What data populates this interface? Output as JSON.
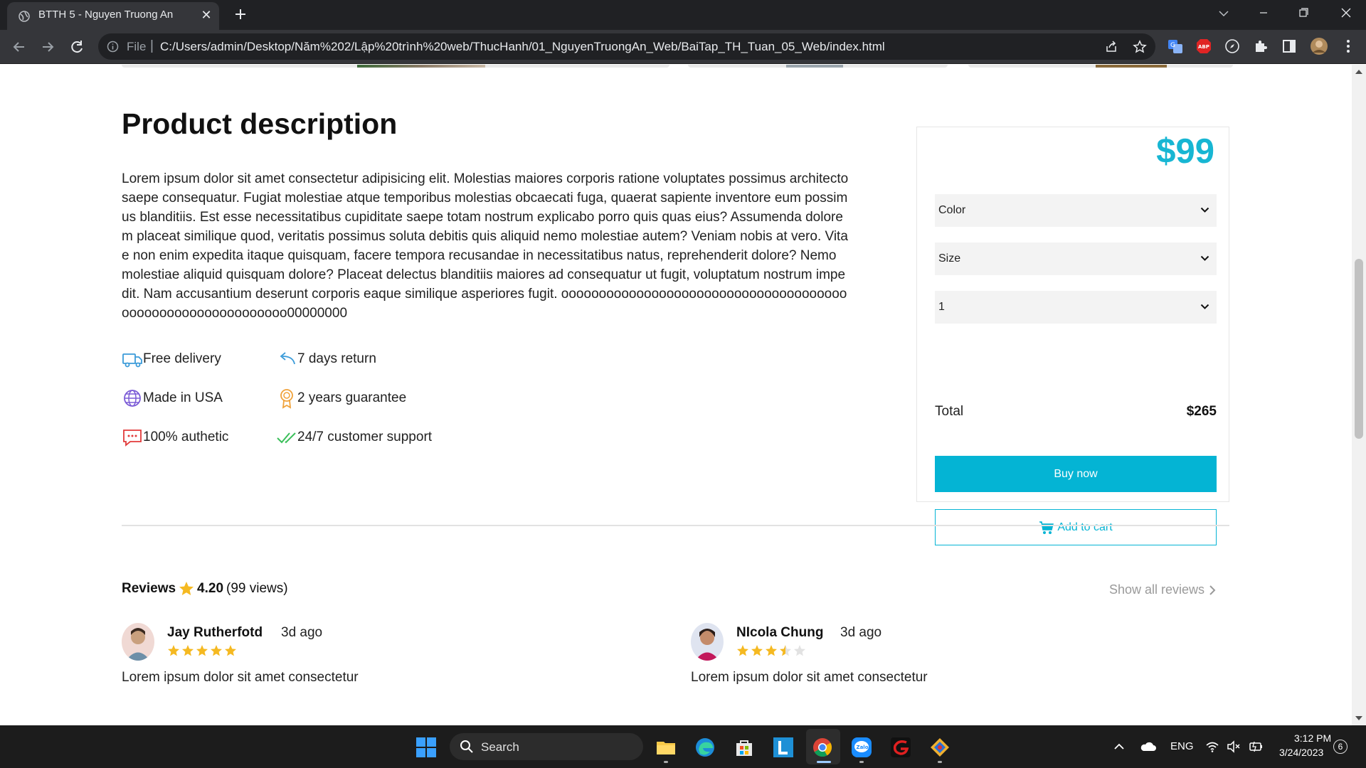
{
  "browser": {
    "tab_title": "BTTH 5 - Nguyen Truong An",
    "tab_close": "✕",
    "url_scheme": "File",
    "url_separator": "|",
    "url": "C:/Users/admin/Desktop/Năm%202/Lập%20trình%20web/ThucHanh/01_NguyenTruongAn_Web/BaiTap_TH_Tuan_05_Web/index.html",
    "extensions": [
      "translate-icon",
      "adblock-icon",
      "compass-icon",
      "puzzle-icon",
      "sidepanel-icon",
      "profile-avatar-icon"
    ]
  },
  "product": {
    "title": "Product description",
    "description": "Lorem ipsum dolor sit amet consectetur adipisicing elit. Molestias maiores corporis ratione voluptates possimus architecto saepe consequatur. Fugiat molestiae atque temporibus molestias obcaecati fuga, quaerat sapiente inventore eum possimus blanditiis. Est esse necessitatibus cupiditate saepe totam nostrum explicabo porro quis quas eius? Assumenda dolorem placeat similique quod, veritatis possimus soluta debitis quis aliquid nemo molestiae autem? Veniam nobis at vero. Vitae non enim expedita itaque quisquam, facere tempora recusandae in necessitatibus natus, reprehenderit dolore? Nemo molestiae aliquid quisquam dolore? Placeat delectus blanditiis maiores ad consequatur ut fugit, voluptatum nostrum impedit. Nam accusantium deserunt corporis eaque similique asperiores fugit. oooooooooooooooooooooooooooooooooooooooooooooooooooooooooooo00000000",
    "features": [
      {
        "label": "Free delivery",
        "icon": "truck-icon",
        "color": "#3b9bd9"
      },
      {
        "label": "7 days return",
        "icon": "return-arrow-icon",
        "color": "#3b9bd9"
      },
      {
        "label": "Made in USA",
        "icon": "globe-icon",
        "color": "#7b5bd6"
      },
      {
        "label": "2 years guarantee",
        "icon": "medal-icon",
        "color": "#f0a23a"
      },
      {
        "label": "100% authetic",
        "icon": "chat-bubble-icon",
        "color": "#e23b3b"
      },
      {
        "label": "24/7 customer support",
        "icon": "double-check-icon",
        "color": "#3bbf5a"
      }
    ]
  },
  "purchase": {
    "price": "$99",
    "color_select": "Color",
    "size_select": "Size",
    "quantity_select": "1",
    "total_label": "Total",
    "total_value": "$265",
    "buy_label": "Buy now",
    "cart_label": "Add to cart",
    "accent": "#04b4d4"
  },
  "reviews": {
    "label": "Reviews",
    "score": "4.20",
    "views": "(99 views)",
    "show_all": "Show all reviews",
    "star_color": "#f5b921",
    "items": [
      {
        "name": "Jay Rutherfotd",
        "time": "3d ago",
        "rating": 5,
        "text": "Lorem ipsum dolor sit amet consectetur"
      },
      {
        "name": "NIcola Chung",
        "time": "3d ago",
        "rating": 3.5,
        "text": "Lorem ipsum dolor sit amet consectetur"
      }
    ]
  },
  "taskbar": {
    "search_label": "Search",
    "language": "ENG",
    "time": "3:12 PM",
    "date": "3/24/2023",
    "notifications": "6"
  }
}
